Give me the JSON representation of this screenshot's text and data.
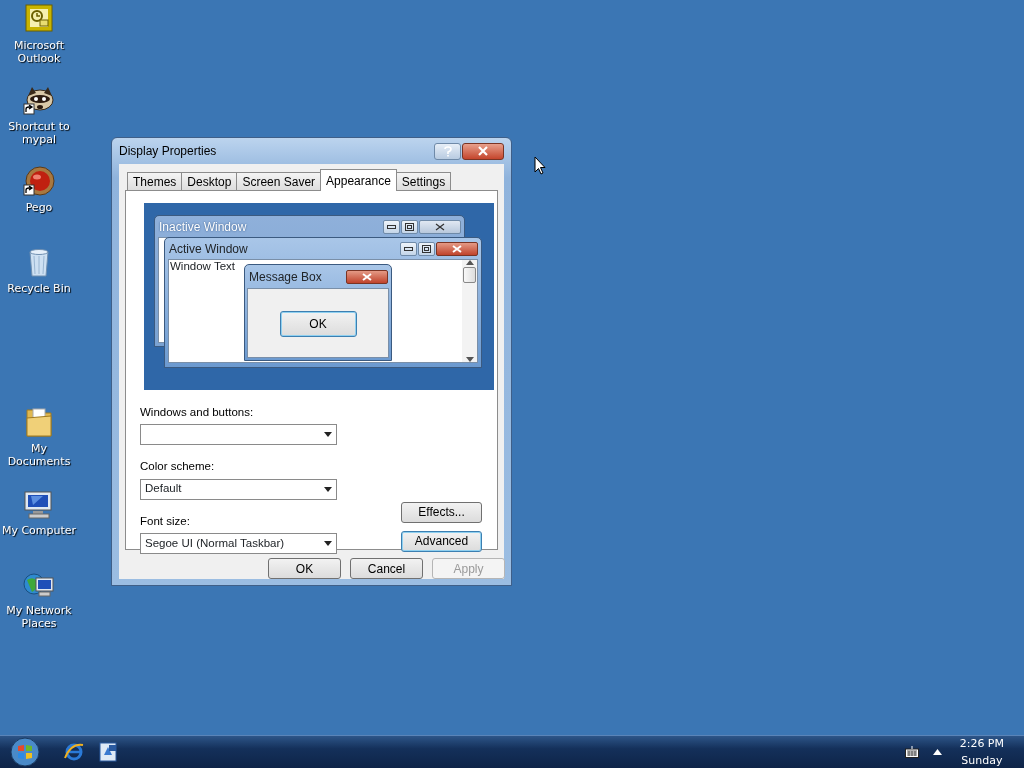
{
  "desktop_icons": [
    {
      "label": "Microsoft Outlook",
      "kind": "outlook",
      "shortcut": false
    },
    {
      "label": "Shortcut to mypal",
      "kind": "raccoon",
      "shortcut": true
    },
    {
      "label": "Pego",
      "kind": "ball",
      "shortcut": true
    },
    {
      "label": "Recycle Bin",
      "kind": "bin",
      "shortcut": false
    },
    {
      "label": "My Documents",
      "kind": "folder",
      "shortcut": false
    },
    {
      "label": "My Computer",
      "kind": "computer",
      "shortcut": false
    },
    {
      "label": "My Network Places",
      "kind": "network",
      "shortcut": false
    }
  ],
  "dialog": {
    "title": "Display Properties",
    "tabs": [
      {
        "label": "Themes",
        "selected": false
      },
      {
        "label": "Desktop",
        "selected": false
      },
      {
        "label": "Screen Saver",
        "selected": false
      },
      {
        "label": "Appearance",
        "selected": true
      },
      {
        "label": "Settings",
        "selected": false
      }
    ],
    "preview": {
      "inactive_title": "Inactive Window",
      "active_title": "Active Window",
      "window_text": "Window Text",
      "message_title": "Message Box",
      "message_button": "OK"
    },
    "fields": [
      {
        "label": "Windows and buttons:"
      },
      {
        "label": "Color scheme:",
        "value": "Default"
      },
      {
        "label": "Font size:",
        "value": "Segoe UI (Normal Taskbar)"
      }
    ],
    "side_buttons": [
      {
        "label": "Effects...",
        "focused": false
      },
      {
        "label": "Advanced",
        "focused": true
      }
    ],
    "buttons": [
      {
        "label": "OK",
        "disabled": false
      },
      {
        "label": "Cancel",
        "disabled": false
      },
      {
        "label": "Apply",
        "disabled": true
      }
    ]
  },
  "taskbar": {
    "quick_launch": [
      {
        "kind": "browser"
      },
      {
        "kind": "app"
      }
    ],
    "time": "2:26 PM",
    "day": "Sunday"
  }
}
